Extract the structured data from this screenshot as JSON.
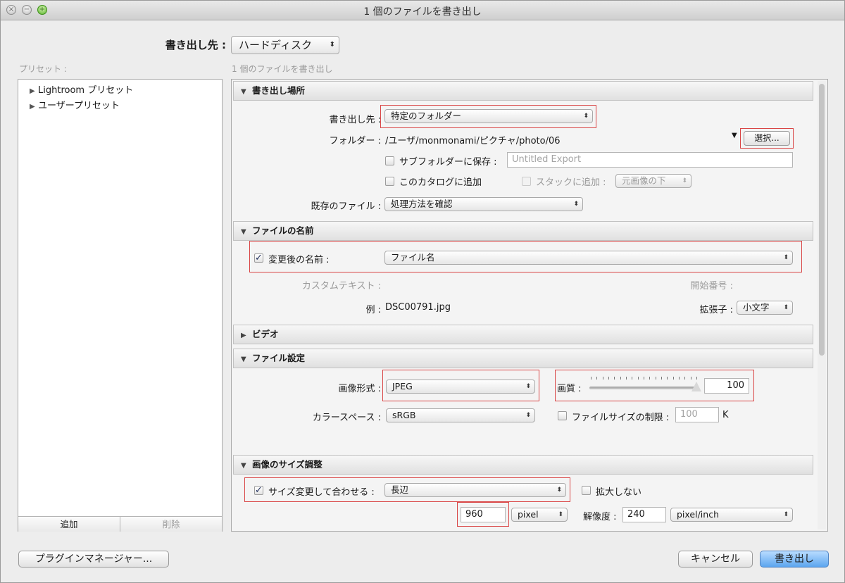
{
  "window": {
    "title": "1 個のファイルを書き出し"
  },
  "top": {
    "export_to_label": "書き出し先 :",
    "export_to_value": "ハードディスク"
  },
  "left": {
    "presets_label": "プリセット :",
    "tree": [
      "Lightroom プリセット",
      "ユーザープリセット"
    ],
    "add_label": "追加",
    "remove_label": "削除"
  },
  "right": {
    "subtitle": "1 個のファイルを書き出し"
  },
  "sections": {
    "location": {
      "title": "書き出し場所",
      "export_to_label": "書き出し先 :",
      "export_to_value": "特定のフォルダー",
      "folder_label": "フォルダー :",
      "folder_path": "/ユーザ/monmonami/ピクチャ/photo/06",
      "choose_label": "選択...",
      "subfolder_label": "サブフォルダーに保存 :",
      "subfolder_value": "Untitled Export",
      "add_catalog_label": "このカタログに追加",
      "stack_label": "スタックに追加 :",
      "stack_value": "元画像の下",
      "existing_label": "既存のファイル :",
      "existing_value": "処理方法を確認"
    },
    "naming": {
      "title": "ファイルの名前",
      "rename_label": "変更後の名前 :",
      "rename_value": "ファイル名",
      "custom_text_label": "カスタムテキスト :",
      "start_number_label": "開始番号 :",
      "example_label": "例 :",
      "example_value": "DSC00791.jpg",
      "extension_label": "拡張子 :",
      "extension_value": "小文字"
    },
    "video": {
      "title": "ビデオ"
    },
    "file_settings": {
      "title": "ファイル設定",
      "format_label": "画像形式 :",
      "format_value": "JPEG",
      "quality_label": "画質 :",
      "quality_value": "100",
      "quality_level": 100,
      "colorspace_label": "カラースペース :",
      "colorspace_value": "sRGB",
      "limit_label": "ファイルサイズの制限 :",
      "limit_value": "100",
      "limit_unit": "K"
    },
    "sizing": {
      "title": "画像のサイズ調整",
      "resize_label": "サイズ変更して合わせる :",
      "resize_value": "長辺",
      "dont_enlarge_label": "拡大しない",
      "size_value": "960",
      "size_unit": "pixel",
      "resolution_label": "解像度 :",
      "resolution_value": "240",
      "resolution_unit": "pixel/inch"
    }
  },
  "bottom": {
    "plugin_manager_label": "プラグインマネージャー...",
    "cancel_label": "キャンセル",
    "export_label": "書き出し"
  }
}
